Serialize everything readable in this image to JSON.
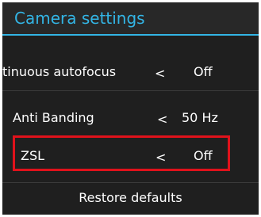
{
  "dialog": {
    "title": "Camera settings"
  },
  "settings": [
    {
      "label": "tinuous autofocus",
      "arrow": "<",
      "value": "Off"
    },
    {
      "label": "Anti Banding",
      "arrow": "<",
      "value": "50 Hz"
    },
    {
      "label": "ZSL",
      "arrow": "<",
      "value": "Off"
    }
  ],
  "footer": {
    "restore_label": "Restore defaults"
  },
  "colors": {
    "accent": "#33b5e5",
    "highlight": "#e0121b",
    "background": "#1f1f1f"
  }
}
